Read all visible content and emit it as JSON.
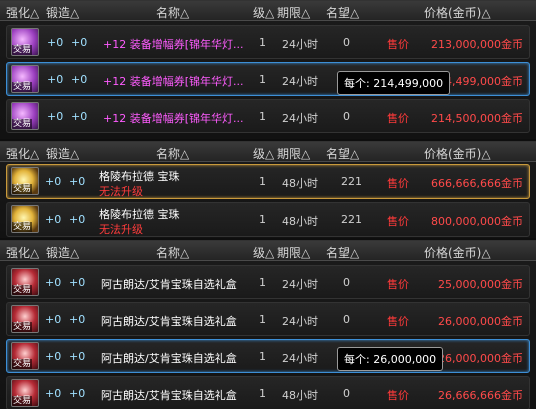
{
  "header": {
    "enhance": "强化△",
    "forge": "锻造△",
    "name": "名称△",
    "level": "级△",
    "duration": "期限△",
    "fame": "名望△",
    "price": "价格(金币)△"
  },
  "groups": [
    {
      "rows": [
        {
          "enhance": "+0",
          "forge": "+0",
          "name": "+12 装备增幅券[锦年华灯...",
          "level": "1",
          "duration": "24小时",
          "fame": "0",
          "price_label": "售价",
          "price": "213,000,000金币",
          "icon": "ticket-icon",
          "trade": "交易"
        },
        {
          "enhance": "+0",
          "forge": "+0",
          "name": "+12 装备增幅券[锦年华灯...",
          "level": "1",
          "duration": "24小时",
          "fame": "",
          "price_label": "售价",
          "price": "4,499,000金币",
          "icon": "ticket-icon",
          "trade": "交易",
          "tooltip": "每个: 214,499,000"
        },
        {
          "enhance": "+0",
          "forge": "+0",
          "name": "+12 装备增幅券[锦年华灯...",
          "level": "1",
          "duration": "24小时",
          "fame": "0",
          "price_label": "售价",
          "price": "214,500,000金币",
          "icon": "ticket-icon",
          "trade": "交易"
        }
      ]
    },
    {
      "rows": [
        {
          "enhance": "+0",
          "forge": "+0",
          "name": "格陵布拉德 宝珠",
          "sub": "无法升级",
          "level": "1",
          "duration": "48小时",
          "fame": "221",
          "price_label": "售价",
          "price": "666,666,666金币",
          "icon": "orb-icon",
          "trade": "交易"
        },
        {
          "enhance": "+0",
          "forge": "+0",
          "name": "格陵布拉德 宝珠",
          "sub": "无法升级",
          "level": "1",
          "duration": "48小时",
          "fame": "221",
          "price_label": "售价",
          "price": "800,000,000金币",
          "icon": "orb-icon",
          "trade": "交易"
        }
      ]
    },
    {
      "rows": [
        {
          "enhance": "+0",
          "forge": "+0",
          "name": "阿古朗达/艾肯宝珠自选礼盒",
          "level": "1",
          "duration": "24小时",
          "fame": "0",
          "price_label": "售价",
          "price": "25,000,000金币",
          "icon": "gift-box-icon",
          "trade": "交易"
        },
        {
          "enhance": "+0",
          "forge": "+0",
          "name": "阿古朗达/艾肯宝珠自选礼盒",
          "level": "1",
          "duration": "24小时",
          "fame": "0",
          "price_label": "售价",
          "price": "26,000,000金币",
          "icon": "gift-box-icon",
          "trade": "交易"
        },
        {
          "enhance": "+0",
          "forge": "+0",
          "name": "阿古朗达/艾肯宝珠自选礼盒",
          "level": "1",
          "duration": "24小时",
          "fame": "",
          "price_label": "售价",
          "price": "26,000,000金币",
          "icon": "gift-box-icon",
          "trade": "交易",
          "tooltip": "每个: 26,000,000"
        },
        {
          "enhance": "+0",
          "forge": "+0",
          "name": "阿古朗达/艾肯宝珠自选礼盒",
          "level": "1",
          "duration": "48小时",
          "fame": "0",
          "price_label": "售价",
          "price": "26,666,666金币",
          "icon": "gift-box-icon",
          "trade": "交易"
        }
      ]
    }
  ],
  "colors": {
    "price": "#ff4a4a",
    "selected_border": "#3d8fd6",
    "gold_border": "#c99a3c",
    "name_purple": "#ff5cff"
  }
}
